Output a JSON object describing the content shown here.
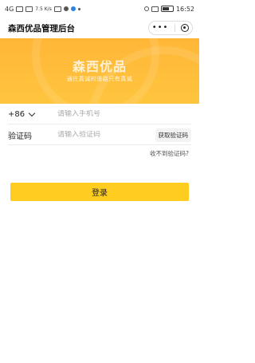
{
  "status_bar": {
    "network": "4G",
    "speed": "7.5 K/s",
    "battery": "100",
    "time": "16:52"
  },
  "nav": {
    "title": "森西优品管理后台",
    "more_icon": "more-dots-icon",
    "close_icon": "target-close-icon"
  },
  "banner": {
    "title": "森西优品",
    "slogan": "通往真诚的道路只有真诚"
  },
  "form": {
    "country_code": "+86",
    "phone_placeholder": "请输入手机号",
    "code_label": "验证码",
    "code_placeholder": "请输入验证码",
    "get_code_label": "获取验证码",
    "no_code_label": "收不到验证码?"
  },
  "login": {
    "label": "登录"
  },
  "colors": {
    "banner": "#ffb637",
    "login_button": "#ffcd1f"
  }
}
